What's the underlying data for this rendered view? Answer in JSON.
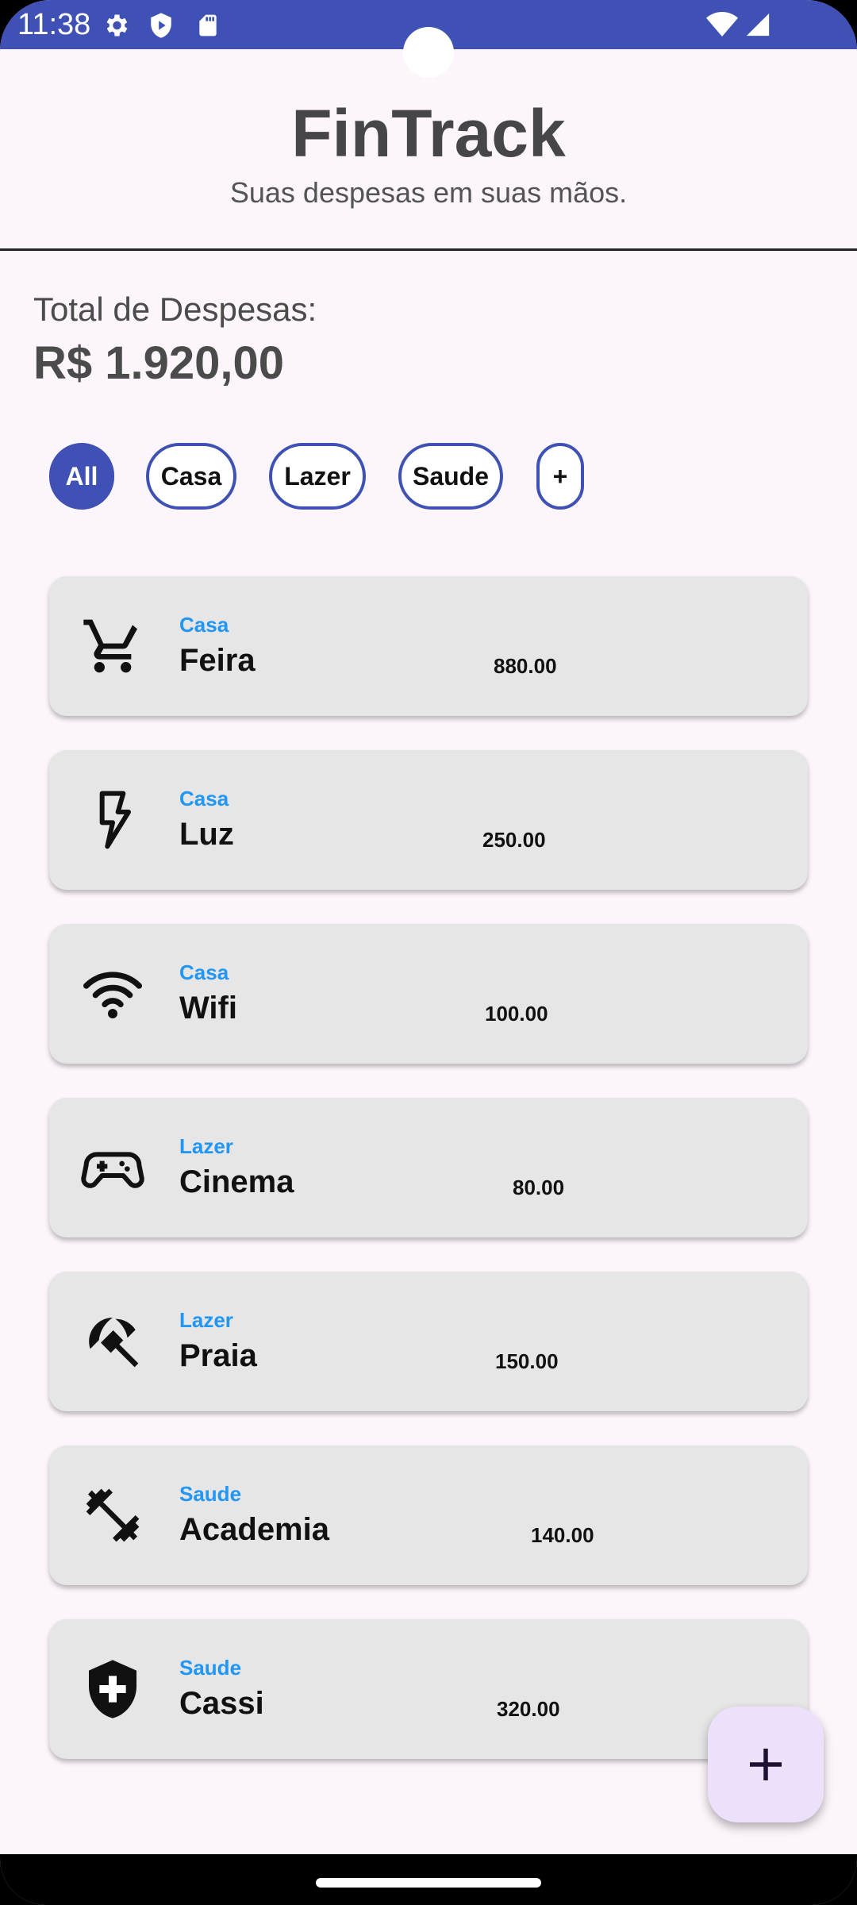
{
  "status_bar": {
    "time": "11:38",
    "color": "#3f51b5",
    "icons_left": [
      "settings-icon",
      "shield-play-icon",
      "sd-card-icon"
    ],
    "icons_right": [
      "wifi-icon",
      "signal-icon"
    ]
  },
  "header": {
    "title": "FinTrack",
    "subtitle": "Suas despesas em suas mãos."
  },
  "summary": {
    "label": "Total de Despesas:",
    "value": "R$ 1.920,00"
  },
  "filters": [
    {
      "label": "All",
      "active": true
    },
    {
      "label": "Casa",
      "active": false
    },
    {
      "label": "Lazer",
      "active": false
    },
    {
      "label": "Saude",
      "active": false
    },
    {
      "label": "+",
      "active": false
    }
  ],
  "expenses": [
    {
      "category": "Casa",
      "name": "Feira",
      "value": "880.00",
      "icon": "shopping-cart-icon"
    },
    {
      "category": "Casa",
      "name": "Luz",
      "value": "250.00",
      "icon": "lightning-icon"
    },
    {
      "category": "Casa",
      "name": "Wifi",
      "value": "100.00",
      "icon": "wifi-icon"
    },
    {
      "category": "Lazer",
      "name": "Cinema",
      "value": "80.00",
      "icon": "gamepad-icon"
    },
    {
      "category": "Lazer",
      "name": "Praia",
      "value": "150.00",
      "icon": "beach-umbrella-icon"
    },
    {
      "category": "Saude",
      "name": "Academia",
      "value": "140.00",
      "icon": "dumbbell-icon"
    },
    {
      "category": "Saude",
      "name": "Cassi",
      "value": "320.00",
      "icon": "health-shield-icon"
    }
  ],
  "fab": {
    "icon": "plus-icon",
    "color": "#ece0fb"
  },
  "colors": {
    "accent": "#3f51b5",
    "category_text": "#2196f3",
    "background": "#fcf5fb",
    "card": "#e6e6e6"
  }
}
